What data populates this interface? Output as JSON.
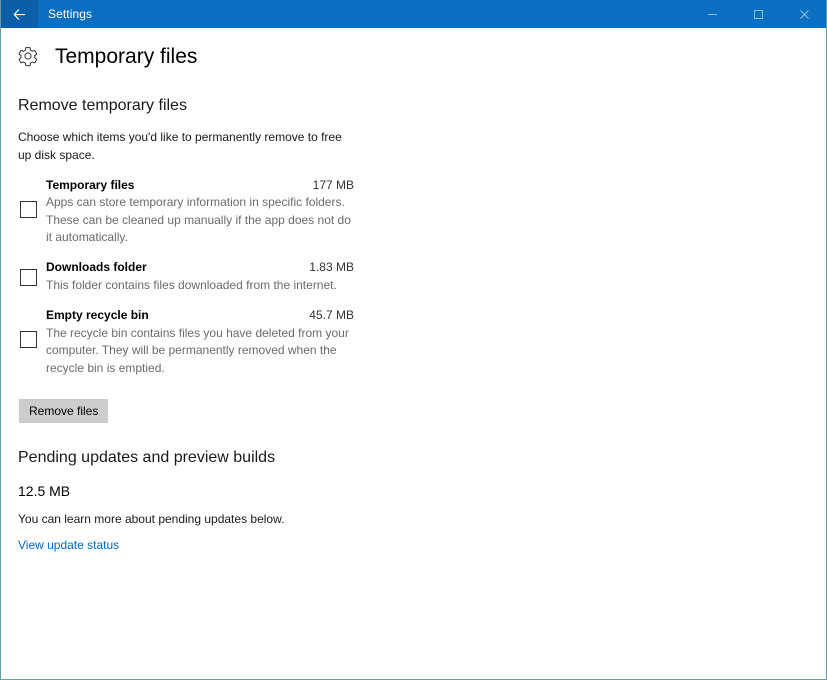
{
  "window": {
    "titlebar": {
      "back_label": "←",
      "back_icon": "back-arrow-icon",
      "title": "Settings",
      "minimize_label": "─",
      "maximize_label": "□",
      "close_label": "✕",
      "background_color": "#0b6fc1",
      "back_button_color": "#0a5fa6"
    },
    "border_color": "#6d9aa8"
  },
  "page": {
    "icon": "gear-icon",
    "title": "Temporary files"
  },
  "remove_section": {
    "heading": "Remove temporary files",
    "description": "Choose which items you'd like to permanently remove to free up disk space.",
    "items": [
      {
        "title": "Temporary files",
        "size": "177 MB",
        "description": "Apps can store temporary information in specific folders. These can be cleaned up manually if the app does not do it automatically.",
        "checked": false
      },
      {
        "title": "Downloads folder",
        "size": "1.83 MB",
        "description": "This folder contains files downloaded from the internet.",
        "checked": false
      },
      {
        "title": "Empty recycle bin",
        "size": "45.7 MB",
        "description": "The recycle bin contains files you have deleted from your computer. They will be permanently removed when the recycle bin is emptied.",
        "checked": false
      }
    ],
    "remove_button_label": "Remove files",
    "remove_button_color": "#cccccc"
  },
  "pending_section": {
    "heading": "Pending updates and preview builds",
    "size": "12.5 MB",
    "description": "You can learn more about pending updates below.",
    "link_label": "View update status",
    "link_color": "#0067c0"
  }
}
